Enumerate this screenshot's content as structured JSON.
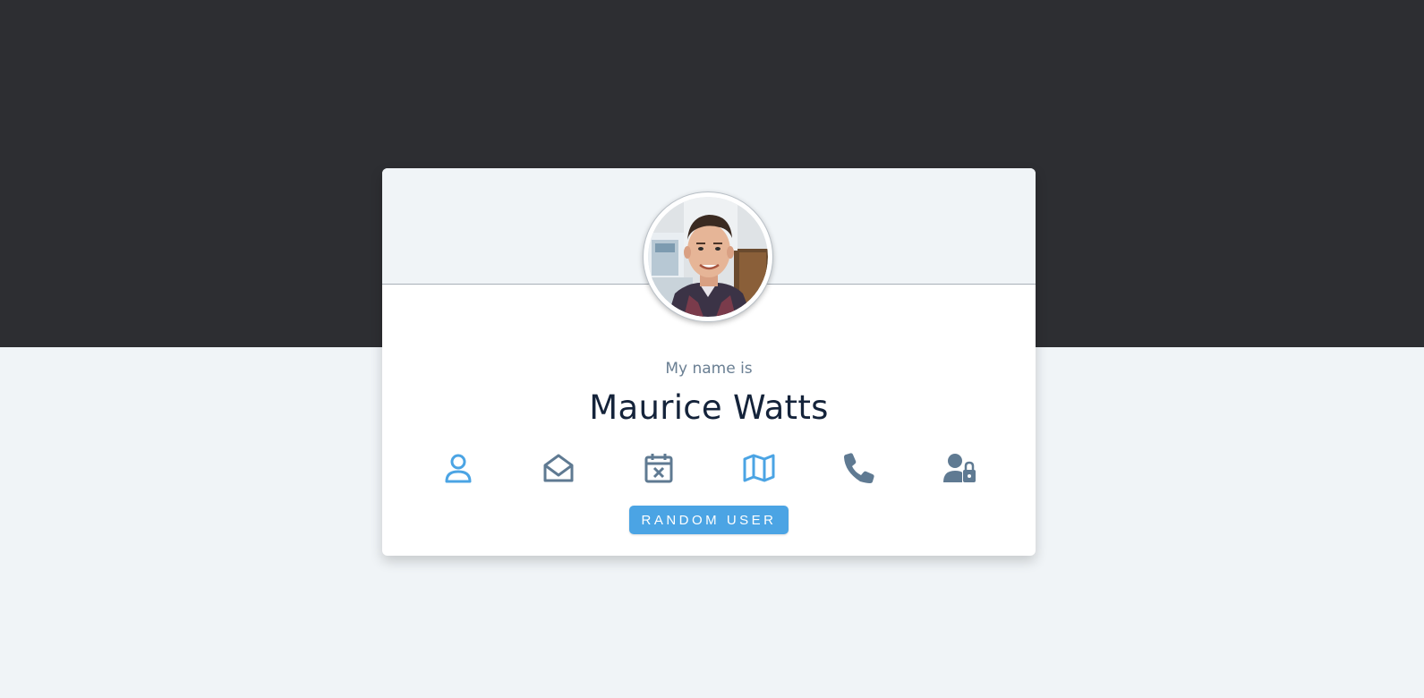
{
  "page": {
    "colors": {
      "top_band": "#2d2e32",
      "page_bg": "#f0f4f7",
      "accent": "#4ba4e4",
      "icon_inactive": "#5f7a92",
      "name_text": "#14233a",
      "label_text": "#6a7f93"
    }
  },
  "card": {
    "avatar_alt": "User profile photo",
    "label": "My name is",
    "value": "Maurice Watts",
    "icons": [
      {
        "name": "user-icon",
        "active": true
      },
      {
        "name": "envelope-open-icon",
        "active": false
      },
      {
        "name": "calendar-times-icon",
        "active": false
      },
      {
        "name": "map-icon",
        "active": true
      },
      {
        "name": "phone-icon",
        "active": false
      },
      {
        "name": "user-lock-icon",
        "active": false
      }
    ],
    "button_label": "RANDOM USER"
  }
}
